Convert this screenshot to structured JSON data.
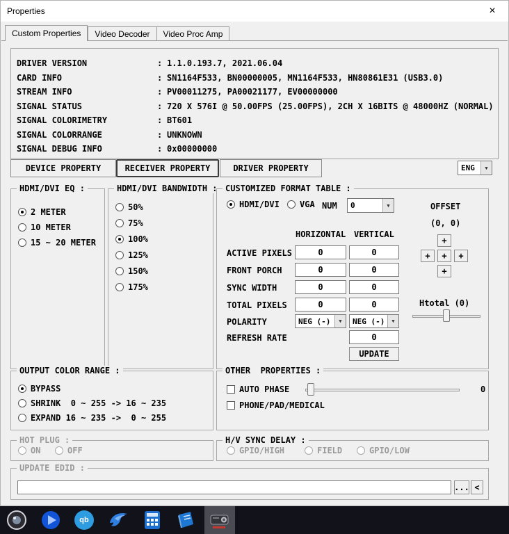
{
  "window": {
    "title": "Properties",
    "close_glyph": "×"
  },
  "tabs": {
    "items": [
      {
        "label": "Custom Properties"
      },
      {
        "label": "Video Decoder"
      },
      {
        "label": "Video Proc Amp"
      }
    ]
  },
  "info": {
    "colon": ":",
    "rows": [
      {
        "label": "DRIVER VERSION",
        "value": "1.1.0.193.7, 2021.06.04"
      },
      {
        "label": "CARD INFO",
        "value": "SN1164F533, BN00000005, MN1164F533, HN80861E31 (USB3.0)"
      },
      {
        "label": "STREAM INFO",
        "value": "PV00011275, PA00021177, EV00000000"
      },
      {
        "label": "SIGNAL STATUS",
        "value": "720 X 576I @ 50.00FPS (25.00FPS), 2CH X 16BITS @ 48000HZ (NORMAL)"
      },
      {
        "label": "SIGNAL COLORIMETRY",
        "value": "BT601"
      },
      {
        "label": "SIGNAL COLORRANGE",
        "value": "UNKNOWN"
      },
      {
        "label": "SIGNAL DEBUG INFO",
        "value": "0x00000000"
      }
    ]
  },
  "property_buttons": {
    "device": "DEVICE PROPERTY",
    "receiver": "RECEIVER PROPERTY",
    "driver": "DRIVER PROPERTY"
  },
  "language": {
    "value": "ENG"
  },
  "eq": {
    "title": "HDMI/DVI EQ :",
    "options": [
      {
        "label": "2 METER"
      },
      {
        "label": "10 METER"
      },
      {
        "label": "15 ~ 20 METER"
      }
    ]
  },
  "bandwidth": {
    "title": "HDMI/DVI BANDWIDTH :",
    "options": [
      {
        "label": "50%"
      },
      {
        "label": "75%"
      },
      {
        "label": "100%"
      },
      {
        "label": "125%"
      },
      {
        "label": "150%"
      },
      {
        "label": "175%"
      }
    ]
  },
  "format": {
    "title": "CUSTOMIZED FORMAT TABLE :",
    "hdmi_label": "HDMI/DVI",
    "vga_label": "VGA",
    "num_label": "NUM",
    "num_value": "0",
    "offset_label": "OFFSET",
    "offset_value": "(0, 0)",
    "plus": "+",
    "horizontal_header": "HORIZONTAL",
    "vertical_header": "VERTICAL",
    "rows": [
      {
        "label": "ACTIVE PIXELS",
        "h": "0",
        "v": "0"
      },
      {
        "label": "FRONT PORCH",
        "h": "0",
        "v": "0"
      },
      {
        "label": "SYNC WIDTH",
        "h": "0",
        "v": "0"
      },
      {
        "label": "TOTAL PIXELS",
        "h": "0",
        "v": "0"
      }
    ],
    "polarity_label": "POLARITY",
    "polarity_h": "NEG (-)",
    "polarity_v": "NEG (-)",
    "refresh_label": "REFRESH RATE",
    "refresh_value": "0",
    "update_label": "UPDATE",
    "htotal_label": "Htotal (0)"
  },
  "output_range": {
    "title": "OUTPUT COLOR RANGE :",
    "options": [
      {
        "label": "BYPASS"
      },
      {
        "label": "SHRINK  0 ~ 255 -> 16 ~ 235"
      },
      {
        "label": "EXPAND 16 ~ 235 ->  0 ~ 255"
      }
    ]
  },
  "other": {
    "title": "OTHER  PROPERTIES :",
    "auto_phase_label": "AUTO PHASE",
    "auto_phase_value": "0",
    "phone_label": "PHONE/PAD/MEDICAL"
  },
  "hot_plug": {
    "title": "HOT PLUG :",
    "on": "ON",
    "off": "OFF"
  },
  "hv_sync": {
    "title": "H/V SYNC DELAY :",
    "options": [
      {
        "label": "GPIO/HIGH"
      },
      {
        "label": "FIELD"
      },
      {
        "label": "GPIO/LOW"
      }
    ]
  },
  "edid": {
    "title": "UPDATE EDID :",
    "value": "",
    "browse": "...",
    "back": "<"
  },
  "taskbar": {
    "qb": "qb"
  }
}
